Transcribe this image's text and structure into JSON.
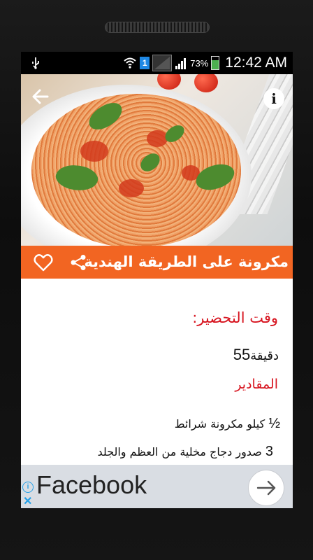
{
  "status_bar": {
    "battery_percent": "73%",
    "time": "12:42 AM",
    "sim_badge": "1",
    "icons": [
      "usb-icon",
      "wifi-icon",
      "signal-icon",
      "battery-charging-icon"
    ]
  },
  "hero": {
    "icons": [
      "back-arrow-icon",
      "info-icon"
    ],
    "info_label": "i"
  },
  "recipe": {
    "title": "مكرونة على الطريقة الهندية",
    "accent_color": "#f26522",
    "actions": [
      "share-icon",
      "heart-icon"
    ]
  },
  "content": {
    "prep_label": "وقت التحضير:",
    "prep_number": "55",
    "prep_unit": "دقيقة",
    "ingredients_label": "المقادير",
    "ingredients": [
      {
        "qty": "½",
        "text": "كيلو مكرونة شرائط"
      },
      {
        "qty": "3",
        "text": "صدور دجاج مخلية من العظم والجلد"
      }
    ],
    "label_color": "#d7141f"
  },
  "ad": {
    "text": "Facebook",
    "info_label": "i",
    "close_label": "✕"
  }
}
